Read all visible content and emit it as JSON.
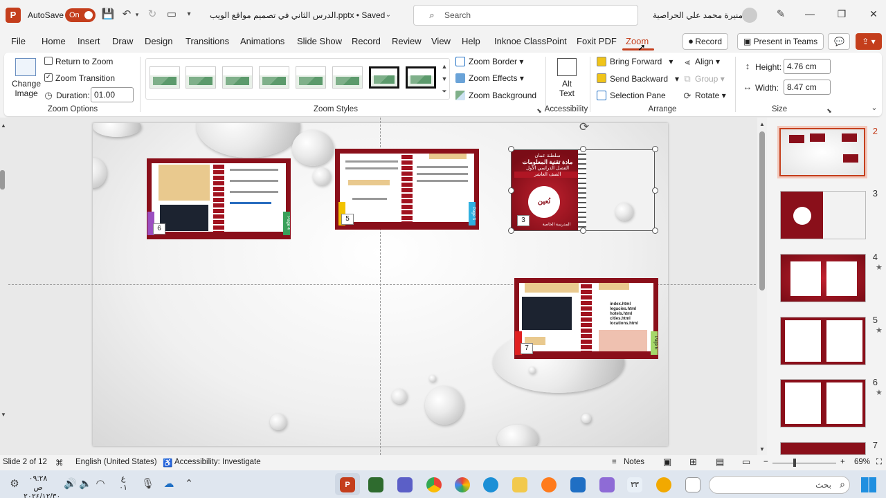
{
  "window": {
    "app_badge": "P",
    "autosave_label": "AutoSave",
    "autosave_state": "On",
    "doc_title": "الدرس الثاني في تصميم مواقع الويب.pptx • Saved",
    "search_placeholder": "Search",
    "user_name": "منيرة محمد علي الحراصية"
  },
  "tabs": [
    "File",
    "Home",
    "Insert",
    "Draw",
    "Design",
    "Transitions",
    "Animations",
    "Slide Show",
    "Record",
    "Review",
    "View",
    "Help",
    "Inknoe ClassPoint",
    "Foxit PDF",
    "Zoom"
  ],
  "active_tab": "Zoom",
  "top_buttons": {
    "record": "Record",
    "present": "Present in Teams"
  },
  "ribbon": {
    "zoom_options": {
      "change_image": "Change Image",
      "return_to_zoom": "Return to Zoom",
      "return_checked": false,
      "zoom_transition": "Zoom Transition",
      "transition_checked": true,
      "duration_label": "Duration:",
      "duration_value": "01.00",
      "group": "Zoom Options"
    },
    "zoom_styles": {
      "group": "Zoom Styles",
      "zoom_border": "Zoom Border",
      "zoom_effects": "Zoom Effects",
      "zoom_background": "Zoom Background"
    },
    "accessibility": {
      "alt_text": "Alt Text",
      "group": "Accessibility"
    },
    "arrange": {
      "bring_forward": "Bring Forward",
      "send_backward": "Send Backward",
      "selection_pane": "Selection Pane",
      "align": "Align",
      "group_btn": "Group",
      "rotate": "Rotate",
      "group": "Arrange"
    },
    "size": {
      "height_label": "Height:",
      "height_value": "4.76 cm",
      "width_label": "Width:",
      "width_value": "8.47 cm",
      "group": "Size"
    }
  },
  "slide": {
    "zooms": [
      {
        "num": "6",
        "side_label": "Page 4"
      },
      {
        "num": "5",
        "side_label": "Page 3"
      },
      {
        "num": "3",
        "title_lines": [
          "سلطنة عمان",
          "مادة تقنية المعلومات",
          "الفصل الدراسي الأول",
          "الصف العاشر"
        ],
        "center_word": "نُعين",
        "footer": "المدرسة الخاصة"
      },
      {
        "num": "7",
        "side_label": "Page 6",
        "files": [
          "index.html",
          "legacies.html",
          "hotels.html",
          "cities.html",
          "locations.html"
        ]
      }
    ]
  },
  "thumbnails": [
    {
      "num": "2",
      "star": false,
      "selected": true
    },
    {
      "num": "3",
      "star": false,
      "selected": false
    },
    {
      "num": "4",
      "star": true,
      "selected": false
    },
    {
      "num": "5",
      "star": true,
      "selected": false
    },
    {
      "num": "6",
      "star": true,
      "selected": false
    },
    {
      "num": "7",
      "star": false,
      "selected": false
    }
  ],
  "statusbar": {
    "slide_info": "Slide 2 of 12",
    "language": "English (United States)",
    "accessibility": "Accessibility: Investigate",
    "notes": "Notes",
    "zoom_minus": "−",
    "zoom_plus": "+",
    "zoom_level": "69%"
  },
  "taskbar": {
    "time": "٠٩:٢٨ ص",
    "date": "٢٠٢٤/١٢/٣٠",
    "lang": "ع",
    "lang_sub": "٠١",
    "search_placeholder": "بحث",
    "badge": "٣٣"
  },
  "colors": {
    "accent": "#c43e1c",
    "notebook_red": "#a1121f"
  }
}
